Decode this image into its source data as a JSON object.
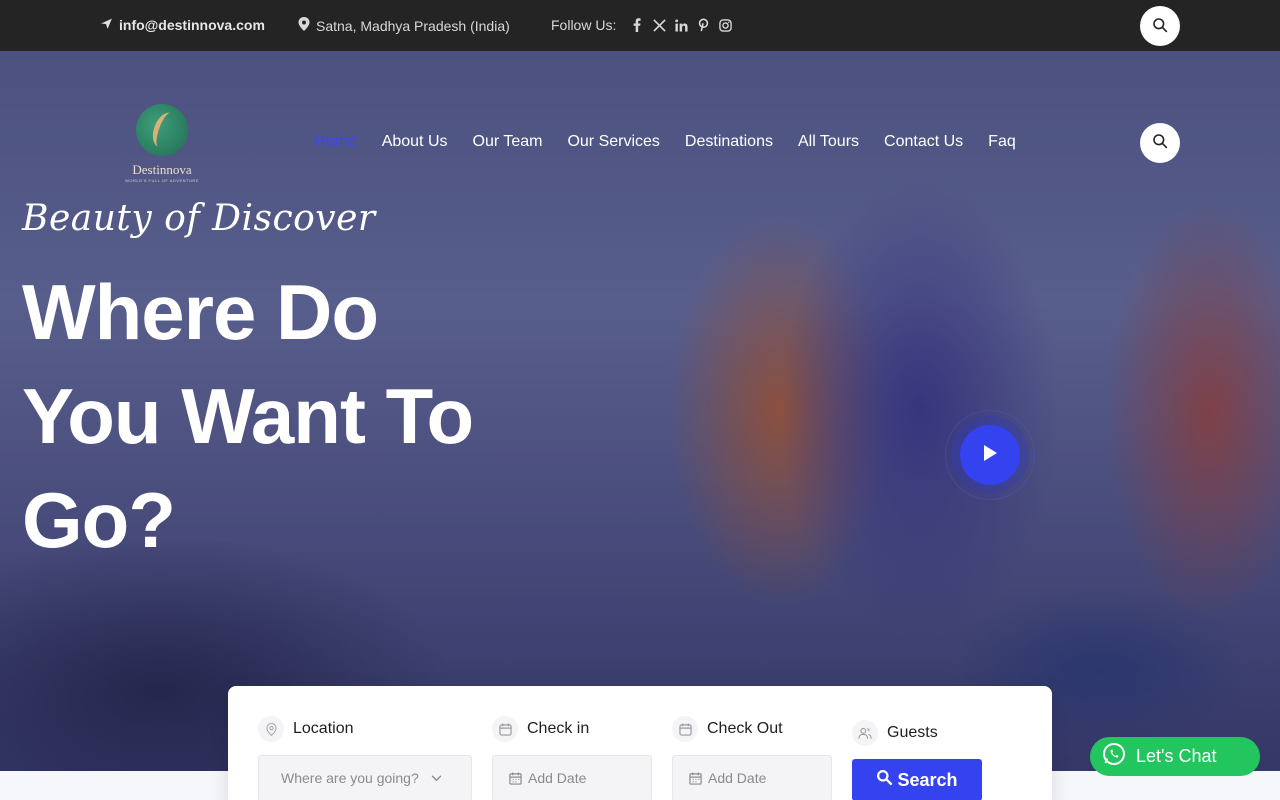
{
  "topbar": {
    "email": "info@destinnova.com",
    "location": "Satna, Madhya Pradesh (India)",
    "follow_label": "Follow Us:",
    "socials": [
      "facebook-icon",
      "x-icon",
      "linkedin-icon",
      "pinterest-icon",
      "instagram-icon"
    ]
  },
  "logo": {
    "name": "Destinnova",
    "tagline": "WORLD'S FULL OF ADVENTURE"
  },
  "nav": {
    "items": [
      {
        "label": "Home",
        "active": true
      },
      {
        "label": "About Us"
      },
      {
        "label": "Our Team"
      },
      {
        "label": "Our Services"
      },
      {
        "label": "Destinations"
      },
      {
        "label": "All Tours"
      },
      {
        "label": "Contact Us"
      },
      {
        "label": "Faq"
      }
    ]
  },
  "hero": {
    "tagline": "Beauty of Discover",
    "headline_1": "Where Do",
    "headline_2": "You Want To",
    "headline_3": "Go?"
  },
  "search": {
    "location_label": "Location",
    "location_placeholder": "Where are you going?",
    "checkin_label": "Check in",
    "checkin_placeholder": "Add Date",
    "checkout_label": "Check Out",
    "checkout_placeholder": "Add Date",
    "guests_label": "Guests",
    "button_label": "Search"
  },
  "chat": {
    "label": "Let's Chat"
  },
  "colors": {
    "accent": "#3442f0",
    "topbar": "#242424",
    "chat": "#22c55e"
  }
}
